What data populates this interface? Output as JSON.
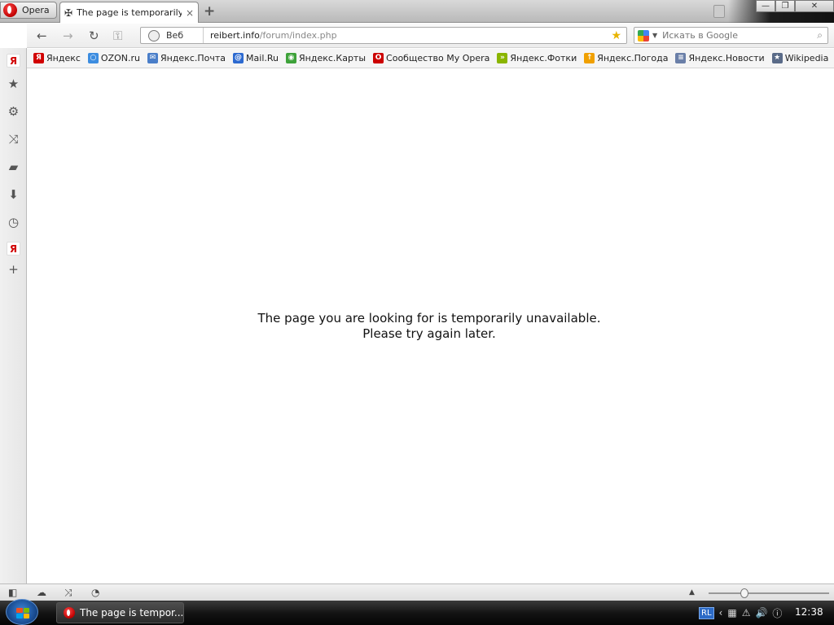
{
  "browser": {
    "menu_label": "Opera",
    "tab": {
      "title": "The page is temporarily ...",
      "close_glyph": "×"
    },
    "new_tab_glyph": "+",
    "window_buttons": {
      "minimize": "—",
      "maximize": "❐",
      "close": "✕"
    }
  },
  "toolbar": {
    "back_glyph": "←",
    "forward_glyph": "→",
    "reload_glyph": "↻",
    "key_glyph": "⚿",
    "site_label": "Веб",
    "url_host": "reibert.info",
    "url_path": "/forum/index.php",
    "search_placeholder": "Искать в Google",
    "search_glyph": "⌕",
    "star_glyph": "★"
  },
  "bookmarks": [
    {
      "label": "Яндекс",
      "icon": "yandex-icon",
      "color": "#d10000",
      "glyph": "Я"
    },
    {
      "label": "OZON.ru",
      "icon": "ozon-icon",
      "color": "#3d8de0",
      "glyph": "○"
    },
    {
      "label": "Яндекс.Почта",
      "icon": "mail-icon",
      "color": "#4a7ec9",
      "glyph": "✉"
    },
    {
      "label": "Mail.Ru",
      "icon": "at-icon",
      "color": "#2d6ad0",
      "glyph": "@"
    },
    {
      "label": "Яндекс.Карты",
      "icon": "maps-icon",
      "color": "#3ea23a",
      "glyph": "◉"
    },
    {
      "label": "Сообщество My Opera",
      "icon": "opera-icon",
      "color": "#cc0000",
      "glyph": "O"
    },
    {
      "label": "Яндекс.Фотки",
      "icon": "photos-icon",
      "color": "#8ab500",
      "glyph": "»"
    },
    {
      "label": "Яндекс.Погода",
      "icon": "weather-icon",
      "color": "#f0a000",
      "glyph": "↑"
    },
    {
      "label": "Яндекс.Новости",
      "icon": "news-icon",
      "color": "#6a7fa8",
      "glyph": "≡"
    },
    {
      "label": "Wikipedia",
      "icon": "wikipedia-icon",
      "color": "#5a6b88",
      "glyph": "★"
    }
  ],
  "panel": [
    {
      "name": "yandex-panel-icon",
      "glyph": "Я",
      "ya": true
    },
    {
      "name": "bookmarks-star-icon",
      "glyph": "★"
    },
    {
      "name": "settings-gear-icon",
      "glyph": "⚙"
    },
    {
      "name": "unite-icon",
      "glyph": "⤨"
    },
    {
      "name": "notes-icon",
      "glyph": "▰"
    },
    {
      "name": "downloads-icon",
      "glyph": "⬇"
    },
    {
      "name": "history-clock-icon",
      "glyph": "◷"
    },
    {
      "name": "yandex-panel-icon-2",
      "glyph": "Я",
      "ya": true
    },
    {
      "name": "add-panel-icon",
      "glyph": "+"
    }
  ],
  "content": {
    "line1": "The page you are looking for is temporarily unavailable.",
    "line2": "Please try again later."
  },
  "statusbar": {
    "panel_toggle_glyph": "◧",
    "turbo_glyph": "☁",
    "unite_glyph": "⤨",
    "speed_glyph": "◔",
    "zoom_up_glyph": "▲",
    "zoom_level": 0.28
  },
  "taskbar": {
    "task_title": "The page is tempor...",
    "lang": "RL",
    "tray_icons": [
      "‹",
      "▦",
      "⚠",
      "🔊",
      "ⓘ"
    ],
    "clock": "12:38",
    "colors": {
      "flag_red": "#f25022",
      "flag_green": "#7fba00",
      "flag_blue": "#00a4ef",
      "flag_yellow": "#ffb900"
    }
  }
}
